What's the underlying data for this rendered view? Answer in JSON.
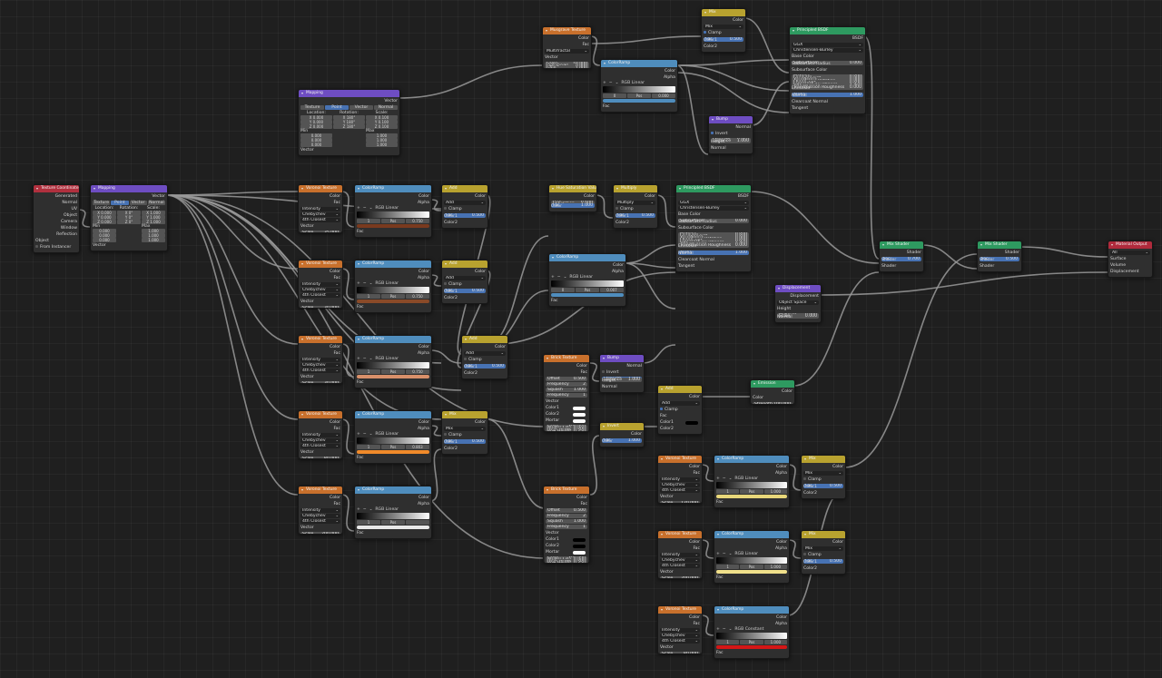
{
  "colors": {
    "texture": "#c8702c",
    "vector": "#6e4dc2",
    "converter": "#4f8dbd",
    "color": "#b8a22f",
    "shader": "#2e9a60",
    "output": "#b02a3c"
  },
  "common": {
    "color": "Color",
    "fac": "Fac",
    "alpha": "Alpha",
    "vector": "Vector",
    "rgb": "RGB",
    "linear": "Linear",
    "constant": "Constant",
    "intensity": "Intensity",
    "chebychev": "Chebychev",
    "closest4": "4th Closest",
    "pos": "Pos",
    "clamp": "Clamp",
    "color1": "Color1",
    "color2": "Color2",
    "shader": "Shader",
    "normal": "Normal",
    "height": "Height",
    "distance": "Distance",
    "strength": "Strength",
    "invert": "Invert",
    "bsdf": "BSDF",
    "scale": "Scale"
  },
  "texcoord": {
    "title": "Texture Coordinate",
    "outputs": [
      "Generated",
      "Normal",
      "UV",
      "Object",
      "Camera",
      "Window",
      "Reflection"
    ],
    "object_label": "Object",
    "from_instancer": "From Instancer"
  },
  "mapping1": {
    "title": "Mapping",
    "modes": [
      "Texture",
      "Point",
      "Vector",
      "Normal"
    ],
    "hdr": [
      "Location:",
      "Rotation:",
      "Scale:"
    ],
    "rows": [
      [
        "X",
        "0.000",
        "X",
        "0°",
        "X",
        "1.000"
      ],
      [
        "Y",
        "0.000",
        "Y",
        "0°",
        "Y",
        "1.000"
      ],
      [
        "Z",
        "0.000",
        "Z",
        "0°",
        "Z",
        "1.000"
      ]
    ],
    "min": "Min",
    "max": "Max",
    "minmax": [
      [
        "0.000",
        "1.000"
      ],
      [
        "0.000",
        "1.000"
      ],
      [
        "0.000",
        "1.000"
      ]
    ]
  },
  "mapping2": {
    "title": "Mapping",
    "modes": [
      "Texture",
      "Point",
      "Vector",
      "Normal"
    ],
    "hdr": [
      "Location:",
      "Rotation:",
      "Scale:"
    ],
    "rows": [
      [
        "X",
        "0.000",
        "X",
        "180°",
        "X",
        "0.100"
      ],
      [
        "Y",
        "0.000",
        "Y",
        "180°",
        "Y",
        "0.100"
      ],
      [
        "Z",
        "0.000",
        "Z",
        "180°",
        "Z",
        "0.100"
      ]
    ],
    "min": "Min",
    "max": "Max",
    "minmax": [
      [
        "0.000",
        "1.000"
      ],
      [
        "0.000",
        "1.000"
      ],
      [
        "0.000",
        "1.000"
      ]
    ]
  },
  "voronoi": [
    {
      "title": "Voronoi Texture",
      "scale": "35.000"
    },
    {
      "title": "Voronoi Texture",
      "scale": "30.000"
    },
    {
      "title": "Voronoi Texture",
      "scale": "30.000"
    },
    {
      "title": "Voronoi Texture",
      "scale": "80.000"
    },
    {
      "title": "Voronoi Texture",
      "scale": "200.000"
    }
  ],
  "ramps": [
    {
      "title": "ColorRamp",
      "idx": "1",
      "pos": "0.750",
      "swatch": "#7a3a1e"
    },
    {
      "title": "ColorRamp",
      "idx": "1",
      "pos": "0.750",
      "swatch": "#8a4a28"
    },
    {
      "title": "ColorRamp",
      "idx": "1",
      "pos": "0.750",
      "swatch": "#d9906a"
    },
    {
      "title": "ColorRamp",
      "idx": "1",
      "pos": "0.803",
      "swatch": "#f08a2a"
    },
    {
      "title": "ColorRamp",
      "idx": "1",
      "pos": "",
      "swatch": "#e8e8e8"
    }
  ],
  "adds": [
    {
      "title": "Add",
      "mode": "Add",
      "fac": "0.500"
    },
    {
      "title": "Add",
      "mode": "Add",
      "fac": "0.500"
    },
    {
      "title": "Add",
      "mode": "Add",
      "fac": "0.500"
    },
    {
      "title": "Mix",
      "mode": "Mix",
      "fac": "0.500"
    }
  ],
  "musgrave": {
    "title": "Musgrave Texture",
    "type": "Multifractal",
    "fields": [
      [
        "Scale",
        "10.000"
      ],
      [
        "Detail",
        "10.000"
      ],
      [
        "Dimension",
        "0.000"
      ],
      [
        "Lacunarity",
        "2.000"
      ],
      [
        "Offset",
        "0.000"
      ],
      [
        "Gain",
        "1.000"
      ]
    ]
  },
  "ramp_top": {
    "title": "ColorRamp",
    "idx": "0",
    "pos": "0.000"
  },
  "mix_top": {
    "title": "Mix",
    "mode": "Mix",
    "fac": "0.500"
  },
  "bump_top": {
    "title": "Bump",
    "strength": "0.050",
    "distance": "1.000"
  },
  "bsdf_top": {
    "title": "Principled BSDF",
    "dist": "GGX",
    "sss": "Christensen-Burley",
    "rows": [
      [
        "Subsurface",
        "0.000"
      ],
      [
        "Subsurface Radius",
        ""
      ],
      [
        "Subsurface Color",
        ""
      ],
      [
        "Metallic",
        "0.000"
      ],
      [
        "Specular",
        "0.500"
      ],
      [
        "Specular Tint",
        "0.000"
      ],
      [
        "Roughness",
        "0.000"
      ],
      [
        "Anisotropic",
        "0.000"
      ],
      [
        "Anisotropic Rotation",
        "0.000"
      ],
      [
        "Sheen",
        "0.000"
      ],
      [
        "Sheen Tint",
        "0.500"
      ],
      [
        "Clearcoat",
        "0.000"
      ],
      [
        "Clearcoat Roughness",
        "0.030"
      ],
      [
        "IOR",
        "1.450"
      ],
      [
        "Transmission",
        "0.000"
      ],
      [
        "Transmission Roughness",
        "0.000"
      ],
      [
        "Emission",
        ""
      ],
      [
        "Alpha",
        "1.000"
      ]
    ],
    "base_color": "Base Color",
    "tail": [
      "Normal",
      "Clearcoat Normal",
      "Tangent"
    ]
  },
  "hsv": {
    "title": "Hue Saturation Value",
    "fields": [
      [
        "Hue",
        "0.500"
      ],
      [
        "Saturation",
        "0.000"
      ],
      [
        "Value",
        "1.000"
      ],
      [
        "Fac",
        "1.000"
      ]
    ]
  },
  "multiply": {
    "title": "Multiply",
    "mode": "Multiply"
  },
  "ramp_mid": {
    "title": "ColorRamp",
    "idx": "0",
    "pos": "0.007"
  },
  "add_mid": {
    "title": "Add",
    "mode": "Add",
    "fac": "0.500"
  },
  "bsdf_mid": {
    "title": "Principled BSDF",
    "dist": "GGX",
    "sss": "Christensen-Burley",
    "rows": [
      [
        "Subsurface",
        "0.000"
      ],
      [
        "Subsurface Radius",
        ""
      ],
      [
        "Subsurface Color",
        ""
      ],
      [
        "Metallic",
        "0.000"
      ],
      [
        "Specular",
        "0.500"
      ],
      [
        "Specular Tint",
        "0.000"
      ],
      [
        "Roughness",
        "0.500"
      ],
      [
        "Anisotropic",
        "0.000"
      ],
      [
        "Anisotropic Rotation",
        "0.000"
      ],
      [
        "Sheen",
        "0.000"
      ],
      [
        "Sheen Tint",
        "0.500"
      ],
      [
        "Clearcoat",
        "0.000"
      ],
      [
        "Clearcoat Roughness",
        "0.030"
      ],
      [
        "IOR",
        "1.450"
      ],
      [
        "Transmission",
        "0.000"
      ],
      [
        "Transmission Roughness",
        "0.000"
      ],
      [
        "Emission",
        ""
      ],
      [
        "Alpha",
        "1.000"
      ]
    ],
    "base_color": "Base Color",
    "tail": [
      "Normal",
      "Clearcoat Normal",
      "Tangent"
    ]
  },
  "brick1": {
    "title": "Brick Texture",
    "fields": [
      [
        "Offset",
        "0.500"
      ],
      [
        "Frequency",
        "2"
      ],
      [
        "Squash",
        "1.000"
      ],
      [
        "Frequency",
        "1"
      ]
    ],
    "sockets": [
      "Vector",
      "Color1",
      "Color2",
      "Mortar"
    ],
    "fields2": [
      [
        "Scale",
        "480.000"
      ],
      [
        "Mortar Size",
        "0.010"
      ],
      [
        "Mortar Smo.",
        "0.000"
      ],
      [
        "Bias",
        "0.000"
      ],
      [
        "Brick Width",
        "0.500"
      ],
      [
        "Row Height",
        "0.250"
      ]
    ]
  },
  "brick2": {
    "title": "Brick Texture",
    "fields": [
      [
        "Offset",
        "0.500"
      ],
      [
        "Frequency",
        "2"
      ],
      [
        "Squash",
        "1.000"
      ],
      [
        "Frequency",
        "1"
      ]
    ],
    "sockets": [
      "Vector",
      "Color1",
      "Color2",
      "Mortar"
    ],
    "fields2": [
      [
        "Scale",
        "480.000"
      ],
      [
        "Mortar Size",
        "0.020"
      ],
      [
        "Mortar Smo.",
        "0.000"
      ],
      [
        "Bias",
        "0.000"
      ],
      [
        "Brick Width",
        "0.500"
      ],
      [
        "Row Height",
        "0.250"
      ]
    ]
  },
  "bump_mid": {
    "title": "Bump",
    "strength": "1.000",
    "distance": "1.000"
  },
  "add_low": {
    "title": "Add",
    "mode": "Add"
  },
  "invert": {
    "title": "Invert",
    "fac": "1.000"
  },
  "emission": {
    "title": "Emission",
    "strength": "100.000"
  },
  "displacement": {
    "title": "Displacement",
    "space": "Object Space",
    "fields": [
      [
        "Height",
        ""
      ],
      [
        "Midlevel",
        "0.000"
      ],
      [
        "Scale",
        "0.000"
      ]
    ]
  },
  "mixshader1": {
    "title": "Mix Shader",
    "fac": "0.700"
  },
  "mixshader2": {
    "title": "Mix Shader",
    "fac": "0.500"
  },
  "output": {
    "title": "Material Output",
    "target": "All",
    "sockets": [
      "Surface",
      "Volume",
      "Displacement"
    ]
  },
  "voronoi_r": [
    {
      "title": "Voronoi Texture",
      "scale": "120.000"
    },
    {
      "title": "Voronoi Texture",
      "scale": "200.000"
    },
    {
      "title": "Voronoi Texture",
      "scale": "80.000"
    }
  ],
  "ramps_r": [
    {
      "title": "ColorRamp",
      "idx": "1",
      "pos": "1.000",
      "mode": "Linear",
      "swatch": "#e8d77a"
    },
    {
      "title": "ColorRamp",
      "idx": "1",
      "pos": "1.000",
      "mode": "Linear",
      "swatch": "#f0e08a"
    },
    {
      "title": "ColorRamp",
      "idx": "1",
      "pos": "1.000",
      "mode": "Constant",
      "swatch": "#d41616"
    }
  ],
  "mix_r": [
    {
      "title": "Mix",
      "mode": "Mix",
      "fac": "0.500"
    },
    {
      "title": "Mix",
      "mode": "Mix",
      "fac": "0.500"
    }
  ]
}
